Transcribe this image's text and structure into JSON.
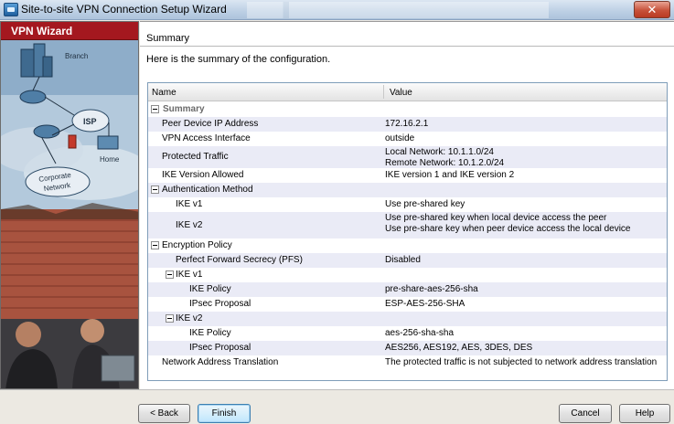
{
  "window": {
    "title": "Site-to-site VPN Connection Setup Wizard",
    "close_label": "✕"
  },
  "side_panel": {
    "header": "VPN Wizard",
    "labels": {
      "branch": "Branch",
      "isp": "ISP",
      "home": "Home",
      "corporate_network_line1": "Corporate",
      "corporate_network_line2": "Network"
    }
  },
  "main": {
    "section_title": "Summary",
    "intro": "Here is the summary of the configuration.",
    "table": {
      "columns": [
        "Name",
        "Value"
      ],
      "rows": [
        {
          "name": "Summary",
          "values": [],
          "toggle": true,
          "kind": "summary"
        },
        {
          "name": "Peer Device IP Address",
          "values": [
            "172.16.2.1"
          ]
        },
        {
          "name": "VPN Access Interface",
          "values": [
            "outside"
          ]
        },
        {
          "name": "Protected Traffic",
          "values": [
            "Local Network: 10.1.1.0/24",
            "Remote Network: 10.1.2.0/24"
          ]
        },
        {
          "name": "IKE Version Allowed",
          "values": [
            "IKE version 1 and IKE version 2"
          ]
        },
        {
          "name": "Authentication Method",
          "values": [],
          "toggle": true
        },
        {
          "name": "IKE v1",
          "values": [
            "Use pre-shared key"
          ]
        },
        {
          "name": "IKE v2",
          "values": [
            "Use pre-shared key when local device access the peer",
            "Use pre-share key when peer device access the local device"
          ]
        },
        {
          "name": "Encryption Policy",
          "values": [],
          "toggle": true
        },
        {
          "name": "Perfect Forward Secrecy (PFS)",
          "values": [
            "Disabled"
          ]
        },
        {
          "name": "IKE v1",
          "values": [],
          "toggle": true
        },
        {
          "name": "IKE Policy",
          "values": [
            "pre-share-aes-256-sha"
          ]
        },
        {
          "name": "IPsec Proposal",
          "values": [
            "ESP-AES-256-SHA"
          ]
        },
        {
          "name": "IKE v2",
          "values": [],
          "toggle": true
        },
        {
          "name": "IKE Policy",
          "values": [
            "aes-256-sha-sha"
          ]
        },
        {
          "name": "IPsec Proposal",
          "values": [
            "AES256, AES192, AES, 3DES, DES"
          ]
        },
        {
          "name": "Network Address Translation",
          "values": [
            "The protected traffic is not subjected to network address translation"
          ]
        }
      ]
    }
  },
  "buttons": {
    "back": "< Back",
    "finish": "Finish",
    "cancel": "Cancel",
    "help": "Help"
  },
  "colors": {
    "wizard_header": "#a4181f",
    "row_alt": "#eaebf6",
    "default_button_border": "#3c7fb1"
  }
}
